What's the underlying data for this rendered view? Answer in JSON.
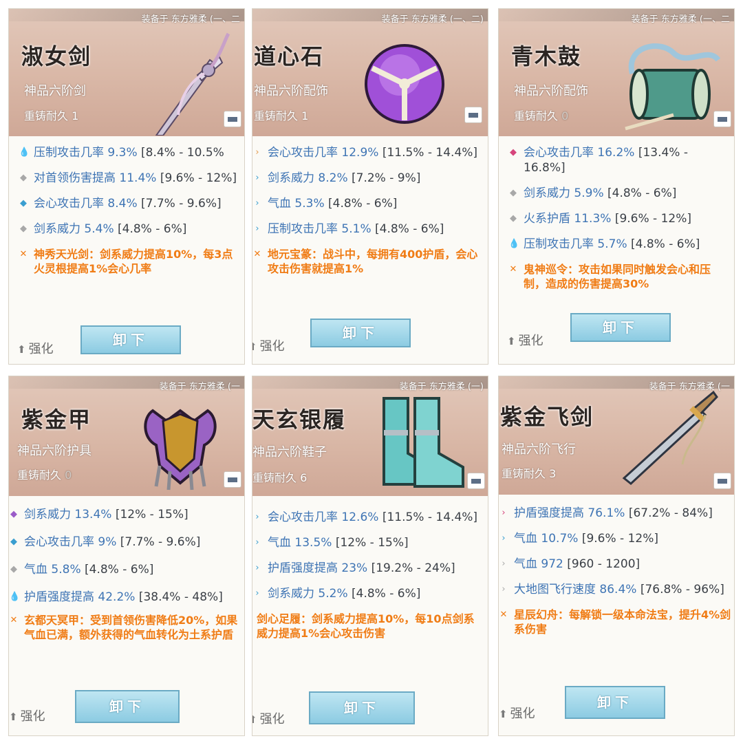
{
  "cards": [
    {
      "equipped": "装备于 东方雅柔 (一、二",
      "name": "淑女剑",
      "grade": "神品六阶剑",
      "durability_label": "重铸耐久",
      "durability_value": "1",
      "item_icon": "sword-art",
      "stats": [
        {
          "bullet": "water-drop-icon",
          "label": "压制攻击几率",
          "value": "9.3%",
          "range": "[8.4% - 10.5%"
        },
        {
          "bullet": "gray-diamond-icon",
          "label": "对首领伤害提高",
          "value": "11.4%",
          "range": "[9.6% - 12%]"
        },
        {
          "bullet": "blue-diamond-icon",
          "label": "会心攻击几率",
          "value": "8.4%",
          "range": "[7.7% - 9.6%]"
        },
        {
          "bullet": "gray-diamond-icon",
          "label": "剑系威力",
          "value": "5.4%",
          "range": "[4.8% - 6%]"
        }
      ],
      "special": "神秀天光剑：剑系威力提高10%，每3点火灵根提高1%会心几率",
      "unequip_label": "卸下",
      "enhance_label": "强化"
    },
    {
      "equipped": "装备于 东方雅柔 (一、二)",
      "name": "道心石",
      "grade": "神品六阶配饰",
      "durability_label": "重铸耐久",
      "durability_value": "1",
      "item_icon": "purple-orb-art",
      "stats": [
        {
          "bullet": "orange-chevron-icon",
          "label": "会心攻击几率",
          "value": "12.9%",
          "range": "[11.5% - 14.4%]"
        },
        {
          "bullet": "blue-chevron-icon",
          "label": "剑系威力",
          "value": "8.2%",
          "range": "[7.2% - 9%]"
        },
        {
          "bullet": "blue-chevron-icon",
          "label": "气血",
          "value": "5.3%",
          "range": "[4.8% - 6%]"
        },
        {
          "bullet": "blue-chevron-icon",
          "label": "压制攻击几率",
          "value": "5.1%",
          "range": "[4.8% - 6%]"
        }
      ],
      "special": "地元宝篆：战斗中，每拥有400护盾，会心攻击伤害就提高1%",
      "unequip_label": "卸下",
      "enhance_label": "强化"
    },
    {
      "equipped": "装备于 东方雅柔 (一、二",
      "name": "青木鼓",
      "grade": "神品六阶配饰",
      "durability_label": "重铸耐久",
      "durability_value": "0",
      "item_icon": "drum-art",
      "stats": [
        {
          "bullet": "pink-diamond-icon",
          "label": "会心攻击几率",
          "value": "16.2%",
          "range": "[13.4% - 16.8%]"
        },
        {
          "bullet": "gray-diamond-icon",
          "label": "剑系威力",
          "value": "5.9%",
          "range": "[4.8% - 6%]"
        },
        {
          "bullet": "gray-diamond-icon",
          "label": "火系护盾",
          "value": "11.3%",
          "range": "[9.6% - 12%]"
        },
        {
          "bullet": "water-drop-icon",
          "label": "压制攻击几率",
          "value": "5.7%",
          "range": "[4.8% - 6%]"
        }
      ],
      "special": "鬼神巡令：攻击如果同时触发会心和压制，造成的伤害提高30%",
      "unequip_label": "卸下",
      "enhance_label": "强化"
    },
    {
      "equipped": "装备于 东方雅柔 (一",
      "name": "紫金甲",
      "grade": "神品六阶护具",
      "durability_label": "重铸耐久",
      "durability_value": "0",
      "item_icon": "armor-art",
      "stats": [
        {
          "bullet": "purple-diamond-icon",
          "label": "剑系威力",
          "value": "13.4%",
          "range": "[12% - 15%]"
        },
        {
          "bullet": "blue-diamond-icon",
          "label": "会心攻击几率",
          "value": "9%",
          "range": "[7.7% - 9.6%]"
        },
        {
          "bullet": "gray-diamond-icon",
          "label": "气血",
          "value": "5.8%",
          "range": "[4.8% - 6%]"
        },
        {
          "bullet": "water-drop-icon",
          "label": "护盾强度提高",
          "value": "42.2%",
          "range": "[38.4% - 48%]"
        }
      ],
      "special": "玄都天冥甲：受到首领伤害降低20%，如果气血已满，额外获得的气血转化为土系护盾",
      "unequip_label": "卸下",
      "enhance_label": "强化"
    },
    {
      "equipped": "装备于 东方雅柔 (一)",
      "name": "天玄银履",
      "grade": "神品六阶鞋子",
      "durability_label": "重铸耐久",
      "durability_value": "6",
      "item_icon": "boots-art",
      "stats": [
        {
          "bullet": "blue-chevron-icon",
          "label": "会心攻击几率",
          "value": "12.6%",
          "range": "[11.5% - 14.4%]"
        },
        {
          "bullet": "blue-chevron-icon",
          "label": "气血",
          "value": "13.5%",
          "range": "[12% - 15%]"
        },
        {
          "bullet": "blue-chevron-icon",
          "label": "护盾强度提高",
          "value": "23%",
          "range": "[19.2% - 24%]"
        },
        {
          "bullet": "blue-chevron-icon",
          "label": "剑系威力",
          "value": "5.2%",
          "range": "[4.8% - 6%]"
        }
      ],
      "special": "剑心足履：剑系威力提高10%，每10点剑系威力提高1%会心攻击伤害",
      "unequip_label": "卸下",
      "enhance_label": "强化"
    },
    {
      "equipped": "装备于 东方雅柔 (一",
      "name": "紫金飞剑",
      "grade": "神品六阶飞行",
      "durability_label": "重铸耐久",
      "durability_value": "3",
      "item_icon": "flying-sword-art",
      "stats": [
        {
          "bullet": "pink-chevron-icon",
          "label": "护盾强度提高",
          "value": "76.1%",
          "range": "[67.2% - 84%]"
        },
        {
          "bullet": "blue-chevron-icon",
          "label": "气血",
          "value": "10.7%",
          "range": "[9.6% - 12%]"
        },
        {
          "bullet": "gray-chevron-icon",
          "label": "气血",
          "value": "972",
          "range": "[960 - 1200]"
        },
        {
          "bullet": "gray-chevron-icon",
          "label": "大地图飞行速度",
          "value": "86.4%",
          "range": "[76.8% - 96%]"
        }
      ],
      "special": "星辰幻舟：每解锁一级本命法宝，提升4%剑系伤害",
      "unequip_label": "卸下",
      "enhance_label": "强化"
    }
  ],
  "colors": {
    "stat_blue": "#3e74b4",
    "special_orange": "#f07c15",
    "button_blue": "#8ccbe2"
  }
}
